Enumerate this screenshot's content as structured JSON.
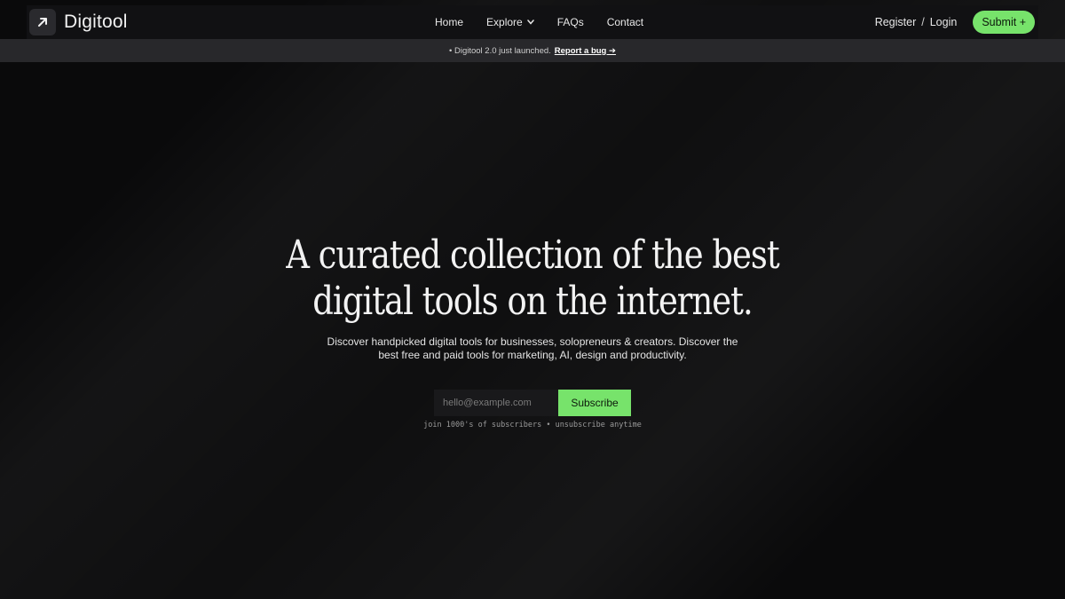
{
  "brand": {
    "name": "Digitool"
  },
  "nav": {
    "links": [
      "Home",
      "Explore",
      "FAQs",
      "Contact"
    ],
    "register": "Register",
    "separator": "/",
    "login": "Login",
    "submit": "Submit +"
  },
  "banner": {
    "text": "• Digitool 2.0 just launched.",
    "link": "Report a bug ➔"
  },
  "hero": {
    "title_line1": "A curated collection of the best",
    "title_line2": "digital tools on the internet.",
    "subtitle_line1": "Discover handpicked digital tools for businesses, solopreneurs & creators. Discover the",
    "subtitle_line2": "best free and paid tools for marketing, AI, design and productivity."
  },
  "signup": {
    "placeholder": "hello@example.com",
    "button": "Subscribe",
    "fineprint": "join 1000's of subscribers • unsubscribe anytime"
  },
  "colors": {
    "accent": "#77e36b",
    "background": "#0a0a0b",
    "banner": "#28282b"
  },
  "icons": [
    "arrow-up-right-icon",
    "chevron-down-icon"
  ]
}
